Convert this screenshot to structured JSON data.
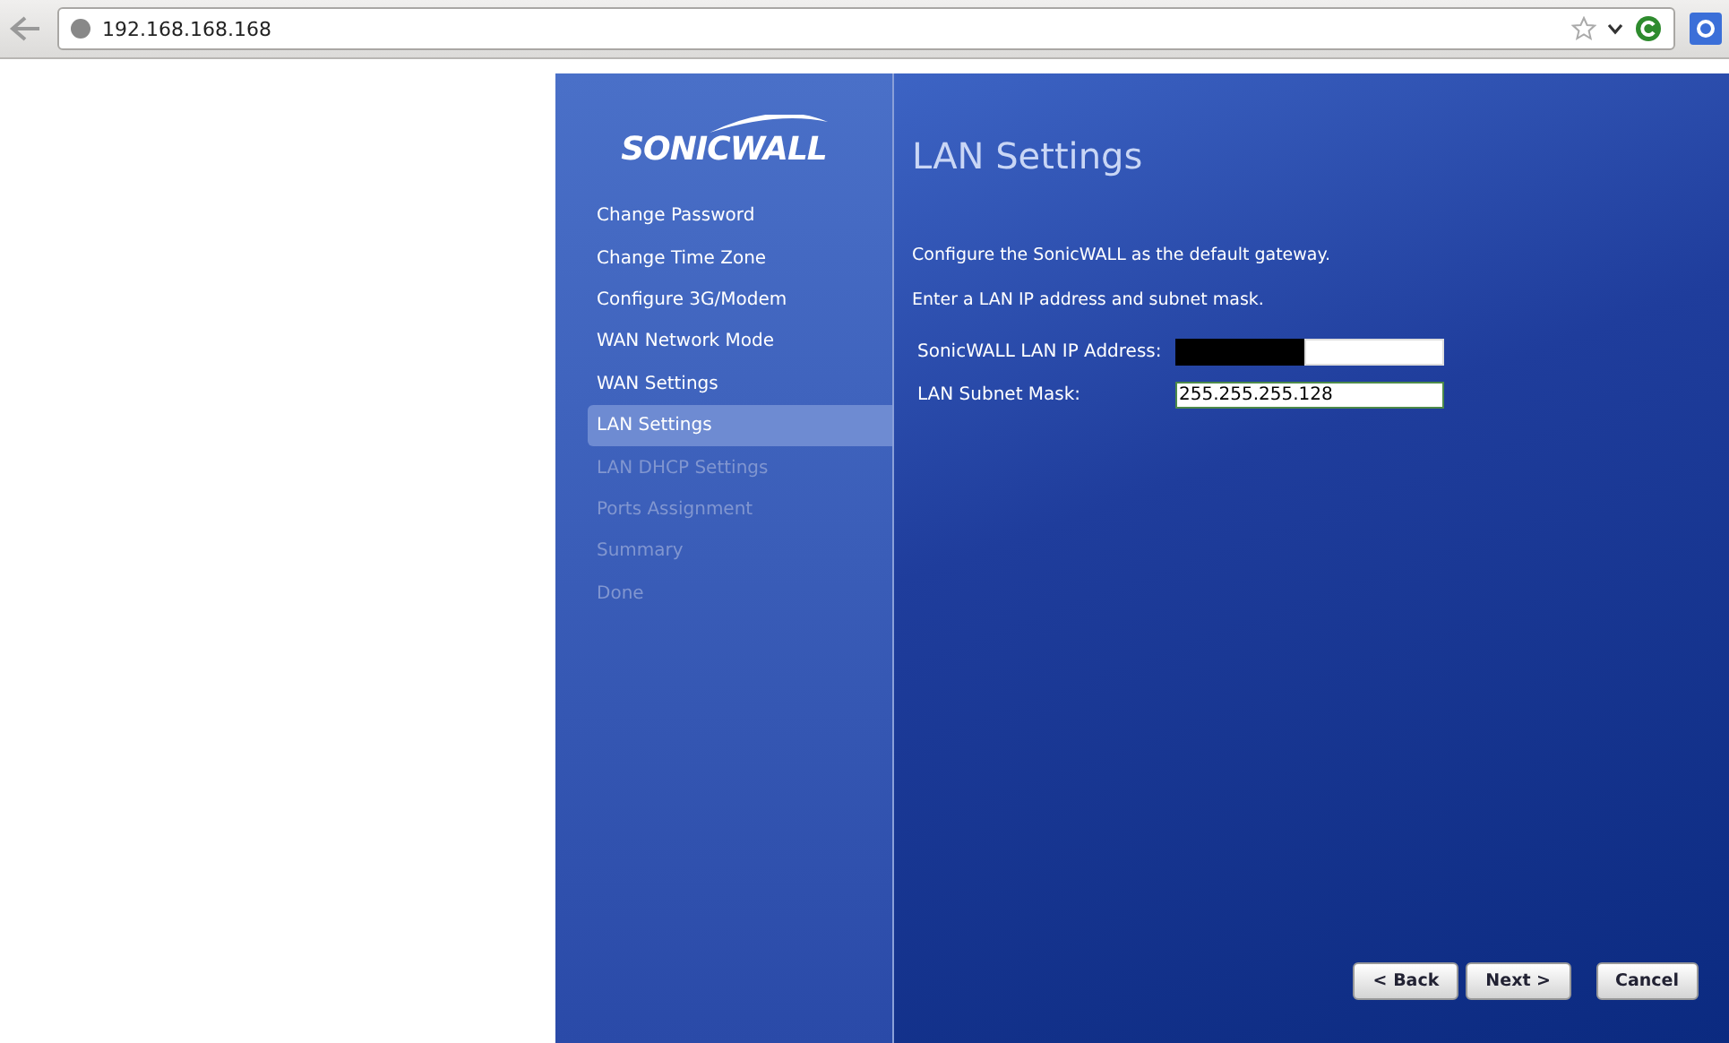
{
  "browser": {
    "address": "192.168.168.168"
  },
  "wizard": {
    "logo": "SONICWALL",
    "steps": [
      {
        "label": "Change Password",
        "selected": false,
        "disabled": false
      },
      {
        "label": "Change Time Zone",
        "selected": false,
        "disabled": false
      },
      {
        "label": "Configure 3G/Modem",
        "selected": false,
        "disabled": false
      },
      {
        "label": "WAN Network Mode",
        "selected": false,
        "disabled": false
      },
      {
        "label": "WAN Settings",
        "selected": false,
        "disabled": false
      },
      {
        "label": "LAN Settings",
        "selected": true,
        "disabled": false
      },
      {
        "label": "LAN DHCP Settings",
        "selected": false,
        "disabled": true
      },
      {
        "label": "Ports Assignment",
        "selected": false,
        "disabled": true
      },
      {
        "label": "Summary",
        "selected": false,
        "disabled": true
      },
      {
        "label": "Done",
        "selected": false,
        "disabled": true
      }
    ],
    "title": "LAN Settings",
    "paragraphs": [
      "Configure the SonicWALL as the default gateway.",
      "Enter a LAN IP address and subnet mask."
    ],
    "fields": [
      {
        "kind": "redacted",
        "label": "SonicWALL LAN IP Address:",
        "focused": false
      },
      {
        "kind": "text",
        "label": "LAN Subnet Mask:",
        "value": "255.255.255.128",
        "focused": true
      }
    ],
    "buttons": [
      "< Back",
      "Next >",
      "Cancel"
    ]
  }
}
